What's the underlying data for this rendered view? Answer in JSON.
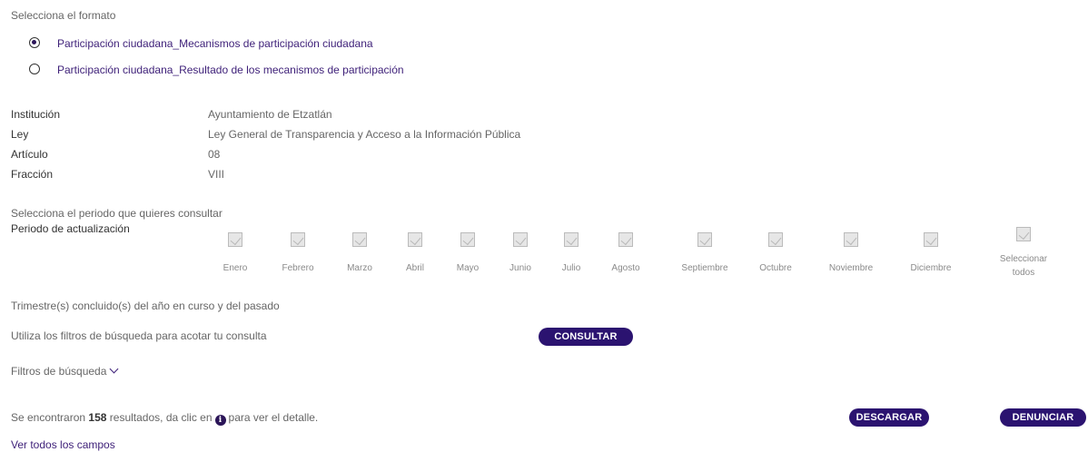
{
  "format_section": {
    "title": "Selecciona el formato",
    "options": [
      {
        "label": "Participación ciudadana_Mecanismos de participación ciudadana",
        "selected": true
      },
      {
        "label": "Participación ciudadana_Resultado de los mecanismos de participación",
        "selected": false
      }
    ]
  },
  "details": {
    "institucion": {
      "label": "Institución",
      "value": "Ayuntamiento de Etzatlán"
    },
    "ley": {
      "label": "Ley",
      "value": "Ley General de Transparencia y Acceso a la Información Pública"
    },
    "articulo": {
      "label": "Artículo",
      "value": "08"
    },
    "fraccion": {
      "label": "Fracción",
      "value": "VIII"
    }
  },
  "period": {
    "prompt": "Selecciona el periodo que quieres consultar",
    "label": "Periodo de actualización",
    "months": [
      "Enero",
      "Febrero",
      "Marzo",
      "Abril",
      "Mayo",
      "Junio",
      "Julio",
      "Agosto",
      "Septiembre",
      "Octubre",
      "Noviembre",
      "Diciembre"
    ],
    "select_all": "Seleccionar todos",
    "note": "Trimestre(s) concluido(s) del año en curso y del pasado"
  },
  "search": {
    "hint": "Utiliza los filtros de búsqueda para acotar tu consulta",
    "consult_button": "CONSULTAR",
    "filters_toggle": "Filtros de búsqueda"
  },
  "results": {
    "prefix": "Se encontraron",
    "count": "158",
    "middle": "resultados, da clic en",
    "suffix": "para ver el detalle.",
    "info_icon_glyph": "i",
    "download_button": "DESCARGAR",
    "report_button": "DENUNCIAR",
    "view_all": "Ver todos los campos"
  }
}
